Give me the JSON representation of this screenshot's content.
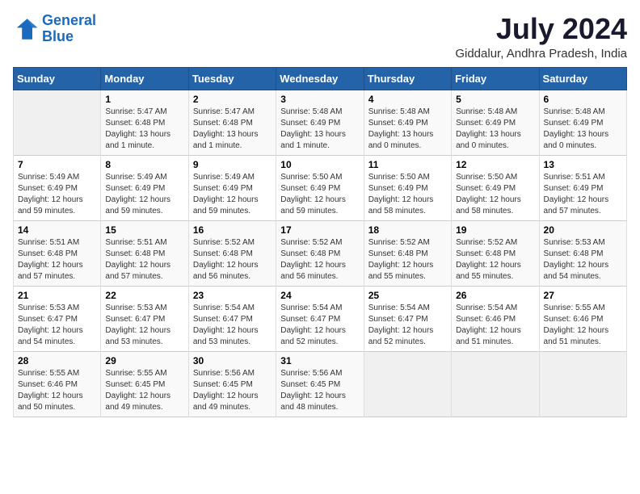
{
  "logo": {
    "line1": "General",
    "line2": "Blue"
  },
  "title": "July 2024",
  "location": "Giddalur, Andhra Pradesh, India",
  "headers": [
    "Sunday",
    "Monday",
    "Tuesday",
    "Wednesday",
    "Thursday",
    "Friday",
    "Saturday"
  ],
  "weeks": [
    [
      {
        "day": "",
        "sunrise": "",
        "sunset": "",
        "daylight": ""
      },
      {
        "day": "1",
        "sunrise": "Sunrise: 5:47 AM",
        "sunset": "Sunset: 6:48 PM",
        "daylight": "Daylight: 13 hours and 1 minute."
      },
      {
        "day": "2",
        "sunrise": "Sunrise: 5:47 AM",
        "sunset": "Sunset: 6:48 PM",
        "daylight": "Daylight: 13 hours and 1 minute."
      },
      {
        "day": "3",
        "sunrise": "Sunrise: 5:48 AM",
        "sunset": "Sunset: 6:49 PM",
        "daylight": "Daylight: 13 hours and 1 minute."
      },
      {
        "day": "4",
        "sunrise": "Sunrise: 5:48 AM",
        "sunset": "Sunset: 6:49 PM",
        "daylight": "Daylight: 13 hours and 0 minutes."
      },
      {
        "day": "5",
        "sunrise": "Sunrise: 5:48 AM",
        "sunset": "Sunset: 6:49 PM",
        "daylight": "Daylight: 13 hours and 0 minutes."
      },
      {
        "day": "6",
        "sunrise": "Sunrise: 5:48 AM",
        "sunset": "Sunset: 6:49 PM",
        "daylight": "Daylight: 13 hours and 0 minutes."
      }
    ],
    [
      {
        "day": "7",
        "sunrise": "Sunrise: 5:49 AM",
        "sunset": "Sunset: 6:49 PM",
        "daylight": "Daylight: 12 hours and 59 minutes."
      },
      {
        "day": "8",
        "sunrise": "Sunrise: 5:49 AM",
        "sunset": "Sunset: 6:49 PM",
        "daylight": "Daylight: 12 hours and 59 minutes."
      },
      {
        "day": "9",
        "sunrise": "Sunrise: 5:49 AM",
        "sunset": "Sunset: 6:49 PM",
        "daylight": "Daylight: 12 hours and 59 minutes."
      },
      {
        "day": "10",
        "sunrise": "Sunrise: 5:50 AM",
        "sunset": "Sunset: 6:49 PM",
        "daylight": "Daylight: 12 hours and 59 minutes."
      },
      {
        "day": "11",
        "sunrise": "Sunrise: 5:50 AM",
        "sunset": "Sunset: 6:49 PM",
        "daylight": "Daylight: 12 hours and 58 minutes."
      },
      {
        "day": "12",
        "sunrise": "Sunrise: 5:50 AM",
        "sunset": "Sunset: 6:49 PM",
        "daylight": "Daylight: 12 hours and 58 minutes."
      },
      {
        "day": "13",
        "sunrise": "Sunrise: 5:51 AM",
        "sunset": "Sunset: 6:49 PM",
        "daylight": "Daylight: 12 hours and 57 minutes."
      }
    ],
    [
      {
        "day": "14",
        "sunrise": "Sunrise: 5:51 AM",
        "sunset": "Sunset: 6:48 PM",
        "daylight": "Daylight: 12 hours and 57 minutes."
      },
      {
        "day": "15",
        "sunrise": "Sunrise: 5:51 AM",
        "sunset": "Sunset: 6:48 PM",
        "daylight": "Daylight: 12 hours and 57 minutes."
      },
      {
        "day": "16",
        "sunrise": "Sunrise: 5:52 AM",
        "sunset": "Sunset: 6:48 PM",
        "daylight": "Daylight: 12 hours and 56 minutes."
      },
      {
        "day": "17",
        "sunrise": "Sunrise: 5:52 AM",
        "sunset": "Sunset: 6:48 PM",
        "daylight": "Daylight: 12 hours and 56 minutes."
      },
      {
        "day": "18",
        "sunrise": "Sunrise: 5:52 AM",
        "sunset": "Sunset: 6:48 PM",
        "daylight": "Daylight: 12 hours and 55 minutes."
      },
      {
        "day": "19",
        "sunrise": "Sunrise: 5:52 AM",
        "sunset": "Sunset: 6:48 PM",
        "daylight": "Daylight: 12 hours and 55 minutes."
      },
      {
        "day": "20",
        "sunrise": "Sunrise: 5:53 AM",
        "sunset": "Sunset: 6:48 PM",
        "daylight": "Daylight: 12 hours and 54 minutes."
      }
    ],
    [
      {
        "day": "21",
        "sunrise": "Sunrise: 5:53 AM",
        "sunset": "Sunset: 6:47 PM",
        "daylight": "Daylight: 12 hours and 54 minutes."
      },
      {
        "day": "22",
        "sunrise": "Sunrise: 5:53 AM",
        "sunset": "Sunset: 6:47 PM",
        "daylight": "Daylight: 12 hours and 53 minutes."
      },
      {
        "day": "23",
        "sunrise": "Sunrise: 5:54 AM",
        "sunset": "Sunset: 6:47 PM",
        "daylight": "Daylight: 12 hours and 53 minutes."
      },
      {
        "day": "24",
        "sunrise": "Sunrise: 5:54 AM",
        "sunset": "Sunset: 6:47 PM",
        "daylight": "Daylight: 12 hours and 52 minutes."
      },
      {
        "day": "25",
        "sunrise": "Sunrise: 5:54 AM",
        "sunset": "Sunset: 6:47 PM",
        "daylight": "Daylight: 12 hours and 52 minutes."
      },
      {
        "day": "26",
        "sunrise": "Sunrise: 5:54 AM",
        "sunset": "Sunset: 6:46 PM",
        "daylight": "Daylight: 12 hours and 51 minutes."
      },
      {
        "day": "27",
        "sunrise": "Sunrise: 5:55 AM",
        "sunset": "Sunset: 6:46 PM",
        "daylight": "Daylight: 12 hours and 51 minutes."
      }
    ],
    [
      {
        "day": "28",
        "sunrise": "Sunrise: 5:55 AM",
        "sunset": "Sunset: 6:46 PM",
        "daylight": "Daylight: 12 hours and 50 minutes."
      },
      {
        "day": "29",
        "sunrise": "Sunrise: 5:55 AM",
        "sunset": "Sunset: 6:45 PM",
        "daylight": "Daylight: 12 hours and 49 minutes."
      },
      {
        "day": "30",
        "sunrise": "Sunrise: 5:56 AM",
        "sunset": "Sunset: 6:45 PM",
        "daylight": "Daylight: 12 hours and 49 minutes."
      },
      {
        "day": "31",
        "sunrise": "Sunrise: 5:56 AM",
        "sunset": "Sunset: 6:45 PM",
        "daylight": "Daylight: 12 hours and 48 minutes."
      },
      {
        "day": "",
        "sunrise": "",
        "sunset": "",
        "daylight": ""
      },
      {
        "day": "",
        "sunrise": "",
        "sunset": "",
        "daylight": ""
      },
      {
        "day": "",
        "sunrise": "",
        "sunset": "",
        "daylight": ""
      }
    ]
  ]
}
